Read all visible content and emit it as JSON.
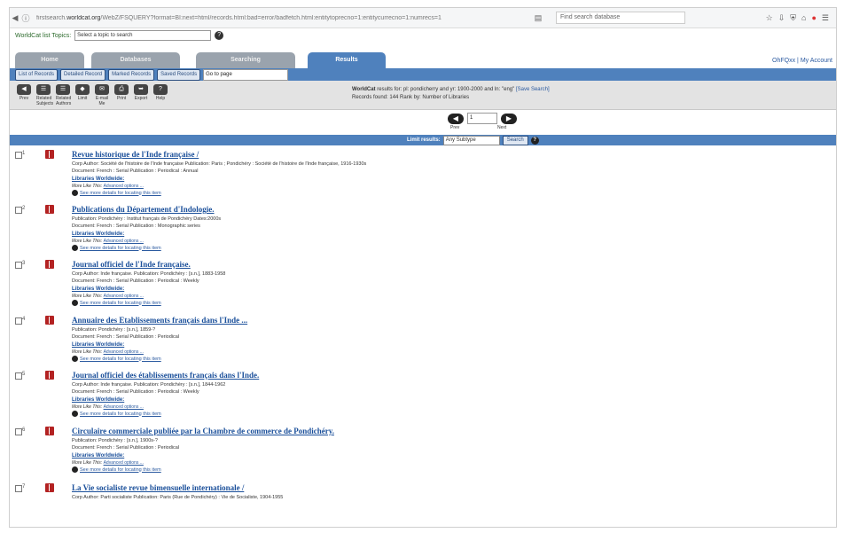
{
  "browser": {
    "url_host": "worldcat.org",
    "url_prefix": "firstsearch.",
    "url_rest": "/WebZ/FSQUERY?format=BI:next=html/records.html:bad=error/badfetch.html:entitytoprecno=1:entitycurrecno=1:numrecs=1",
    "search_placeholder": "Find search database",
    "icons": [
      "back-icon",
      "info-icon",
      "star-icon",
      "reader-icon",
      "downloads-icon",
      "home-icon",
      "shield-icon",
      "addon-icon",
      "menu-icon"
    ]
  },
  "scope": {
    "label": "WorldCat list Topics:",
    "select_value": "Select a topic to search",
    "help": "?"
  },
  "tabs": [
    {
      "label": "Home"
    },
    {
      "label": "Databases"
    },
    {
      "label": "Searching"
    },
    {
      "label": "Results"
    }
  ],
  "top_links": "OhFQxx | My Account",
  "buttons": [
    {
      "label": "List of Records"
    },
    {
      "label": "Detailed Record"
    },
    {
      "label": "Marked Records"
    },
    {
      "label": "Saved Records"
    }
  ],
  "go_to_page": "Go to page",
  "actions": [
    {
      "icon": "prev-icon",
      "label": "Prev"
    },
    {
      "icon": "related-icon",
      "label": "Related Subjects"
    },
    {
      "icon": "related-authors-icon",
      "label": "Related Authors"
    },
    {
      "icon": "limit-icon",
      "label": "Limit"
    },
    {
      "icon": "email-icon",
      "label": "E-mail Me"
    },
    {
      "icon": "print-icon",
      "label": "Print"
    },
    {
      "icon": "export-icon",
      "label": "Export"
    },
    {
      "icon": "help-icon",
      "label": "Help"
    }
  ],
  "modified": {
    "line1_pre": "WorldCat",
    "line1": "results for: pl: pondicherry and yr: 1900-2000 and ln: \"eng\"",
    "save_search": "[Save Search]",
    "line2": "Records found: 144  Rank by: Number of Libraries"
  },
  "pager": {
    "page": "1",
    "prev_label": "Prev",
    "next_label": "Next"
  },
  "limit": {
    "label": "Limit results:",
    "select": "Any Subtype",
    "search": "Search",
    "help": "?"
  },
  "results": [
    {
      "num": "1",
      "title": "Revue historique de l'Inde française /",
      "line1": "Corp Author: Société de l'histoire de l'Inde française  Publication: Paris ; Pondichéry : Société de l'histoire de l'Inde française, 1916-1930s",
      "line2": "Document: French : Serial Publication : Periodical : Annual",
      "libraries": "Libraries Worldwide: ",
      "more": "More Like This: ",
      "more_link": "Advanced options ...",
      "details": "See more details for locating this item"
    },
    {
      "num": "2",
      "title": "Publications du Département d'Indologie.",
      "line1": "Publication: Pondichéry : Institut français de Pondichéry Dates:2000s",
      "line2": "Document: French : Serial Publication : Monographic series",
      "libraries": "Libraries Worldwide: ",
      "more": "More Like This: ",
      "more_link": "Advanced options ...",
      "details": "See more details for locating this item"
    },
    {
      "num": "3",
      "title": "Journal officiel de l'Inde française.",
      "line1": "Corp Author: Inde française.  Publication: Pondichéry : [s.n.], 1883-1958",
      "line2": "Document: French : Serial Publication : Periodical : Weekly",
      "libraries": "Libraries Worldwide: ",
      "more": "More Like This: ",
      "more_link": "Advanced options ...",
      "details": "See more details for locating this item"
    },
    {
      "num": "4",
      "title": "Annuaire des Etablissements français dans l'Inde ...",
      "line1": "Publication: Pondichéry : [s.n.], 1859-?",
      "line2": "Document: French : Serial Publication : Periodical",
      "libraries": "Libraries Worldwide: ",
      "more": "More Like This: ",
      "more_link": "Advanced options ...",
      "details": "See more details for locating this item"
    },
    {
      "num": "5",
      "title": "Journal officiel des établissements français dans l'Inde.",
      "line1": "Corp Author: Inde française.  Publication: Pondichéry : [s.n.], 1844-1962",
      "line2": "Document: French : Serial Publication : Periodical : Weekly",
      "libraries": "Libraries Worldwide: ",
      "more": "More Like This: ",
      "more_link": "Advanced options ...",
      "details": "See more details for locating this item"
    },
    {
      "num": "6",
      "title": "Circulaire commerciale publiée par la Chambre de commerce de Pondichéry.",
      "line1": "Publication: Pondichéry : [s.n.], 1900s-?",
      "line2": "Document: French : Serial Publication : Periodical",
      "libraries": "Libraries Worldwide: ",
      "more": "More Like This: ",
      "more_link": "Advanced options ...",
      "details": "See more details for locating this item"
    },
    {
      "num": "7",
      "title": "La Vie socialiste revue bimensuelle internationale /",
      "line1": "Corp Author: Parti socialiste  Publication: Paris (Rue de Pondichéry) : Vie de Socialiste, 1904-1955",
      "line2": "",
      "libraries": "",
      "more": "",
      "more_link": "",
      "details": ""
    }
  ]
}
